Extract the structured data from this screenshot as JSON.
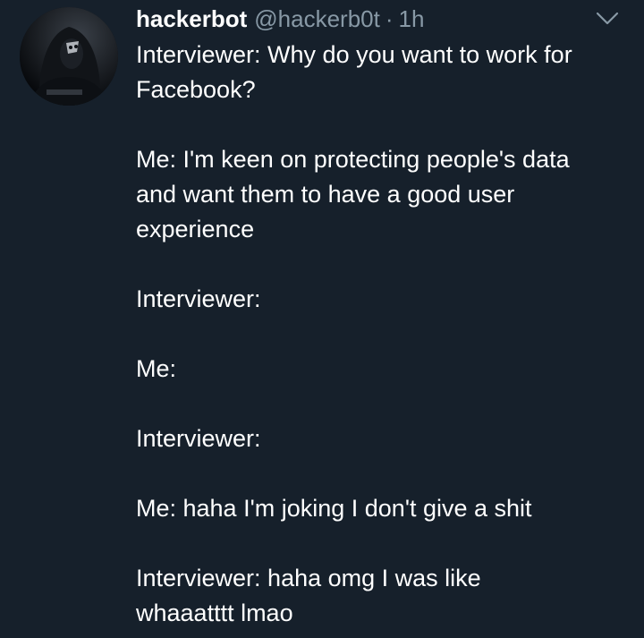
{
  "tweet": {
    "author": {
      "display_name": "hackerbot",
      "handle": "@hackerb0t",
      "avatar_icon": "hooded-hacker-avatar"
    },
    "separator": "·",
    "timestamp": "1h",
    "menu_icon": "chevron-down-icon",
    "paragraphs": [
      "Interviewer: Why do you want to work for\nFacebook?",
      "Me: I'm keen on protecting people's data\nand want them to have a good user\nexperience",
      "Interviewer:",
      "Me:",
      "Interviewer:",
      "Me: haha I'm joking I don't give a shit",
      "Interviewer: haha omg I was like\nwhaaatttt lmao"
    ]
  },
  "colors": {
    "background": "#16202b",
    "text_primary": "#ffffff",
    "text_secondary": "#8899a6"
  }
}
